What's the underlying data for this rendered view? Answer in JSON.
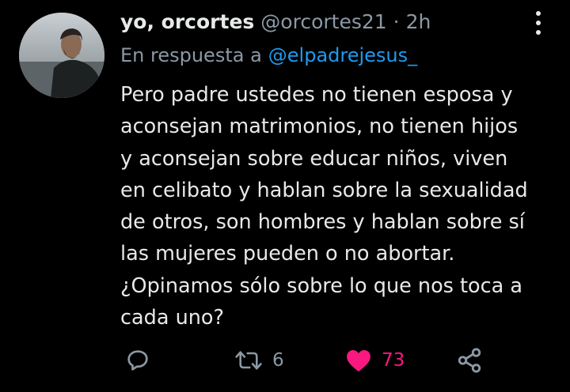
{
  "tweet": {
    "display_name": "yo, orcortes",
    "handle": "@orcortes21",
    "separator": "·",
    "time": "2h",
    "reply_prefix": "En respuesta a",
    "reply_to": "@elpadrejesus_",
    "text_lines": [
      "Pero padre ustedes no tienen esposa y",
      "aconsejan matrimonios, no tienen hijos",
      "y aconsejan sobre educar niños, viven",
      "en celibato y hablan sobre la sexualidad",
      "de otros, son hombres y hablan sobre sí",
      "las mujeres pueden o no abortar.",
      "¿Opinamos sólo sobre lo que nos toca a",
      "cada uno?"
    ],
    "actions": {
      "reply_count": "",
      "retweet_count": "6",
      "like_count": "73",
      "liked": true
    }
  },
  "colors": {
    "background": "#000000",
    "text": "#e7e9ea",
    "secondary": "#8b98a5",
    "mention": "#1d9bf0",
    "like": "#f91880"
  },
  "icons": {
    "more": "more-vertical-icon",
    "reply": "reply-icon",
    "retweet": "retweet-icon",
    "like": "heart-filled-icon",
    "share": "share-icon"
  }
}
